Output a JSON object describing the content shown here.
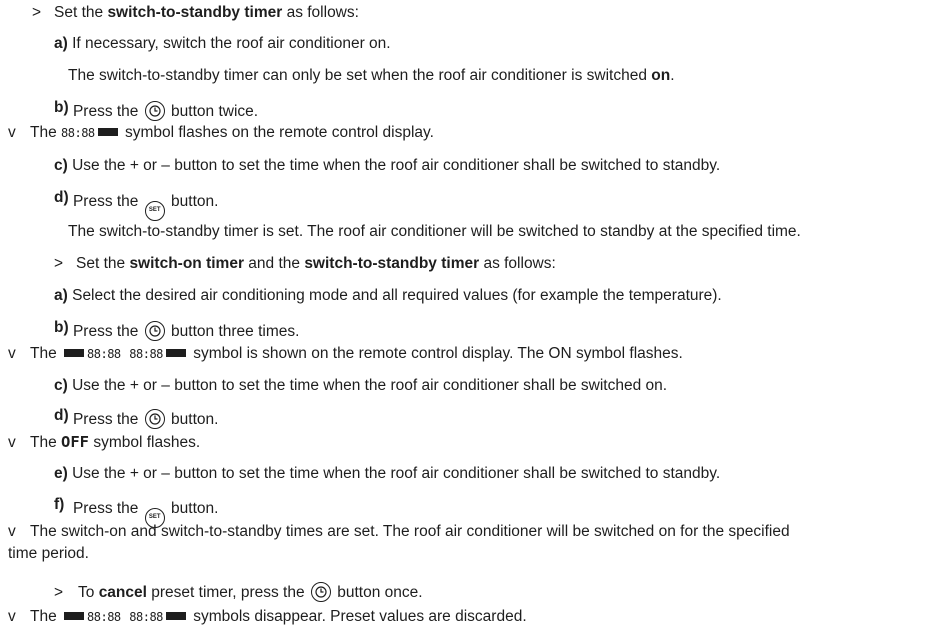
{
  "markers": {
    "step": ">",
    "result": "v"
  },
  "lines": [
    {
      "pre": "Set the ",
      "b1": "switch-to-standby timer",
      "post": " as follows:"
    },
    {
      "label": "a)",
      "text": " If necessary, switch the roof air conditioner on."
    },
    {
      "pre": "The switch-to-standby timer can only be set when the roof air conditioner is switched ",
      "b1": "on",
      "post": "."
    },
    {
      "label": "b)",
      "pre": " Press the ",
      "post": " button twice."
    },
    {
      "pre": "The ",
      "seg": "88:88",
      "post": " symbol flashes on the remote control display."
    },
    {
      "label": "c)",
      "text": " Use the + or – button to set the time when the roof air conditioner shall be switched to standby."
    },
    {
      "label": "d)",
      "pre": " Press the ",
      "post": " button."
    },
    {
      "text": "The switch-to-standby timer is set. The roof air conditioner will be switched to standby at the specified time."
    },
    {
      "pre": "Set the ",
      "b1": "switch-on timer",
      "mid": " and the ",
      "b2": "switch-to-standby timer",
      "post": " as follows:"
    },
    {
      "label": "a)",
      "text": " Select the desired air conditioning mode and all required values (for example the temperature)."
    },
    {
      "label": "b)",
      "pre": " Press the ",
      "post": " button three times."
    },
    {
      "pre": "The ",
      "seg1": "88:88",
      "seg2": "88:88",
      "post": " symbol is shown on the remote control display. The ON symbol flashes."
    },
    {
      "label": "c)",
      "text": " Use the + or – button to set the time when the roof air conditioner shall be switched on."
    },
    {
      "label": "d)",
      "pre": " Press the ",
      "post": " button."
    },
    {
      "pre": "The ",
      "mono": "OFF",
      "post": " symbol flashes."
    },
    {
      "label": "e)",
      "text": " Use the + or – button to set the time when the roof air conditioner shall be switched to standby."
    },
    {
      "label": "f)",
      "pre": " Press the ",
      "post": " button."
    },
    {
      "text": "The switch-on and switch-to-standby times are set. The roof air conditioner will be switched on for the specified"
    },
    {
      "text": "time period."
    },
    {
      "pre": "To ",
      "b1": "cancel",
      "mid": " preset timer, press the ",
      "post": " button once."
    },
    {
      "pre": "The ",
      "seg1": "88:88",
      "seg2": "88:88",
      "post": " symbols disappear. Preset values are discarded."
    }
  ],
  "icons": {
    "timer": "clock-button-icon",
    "set": "set-button-icon",
    "set_label": "SET"
  }
}
